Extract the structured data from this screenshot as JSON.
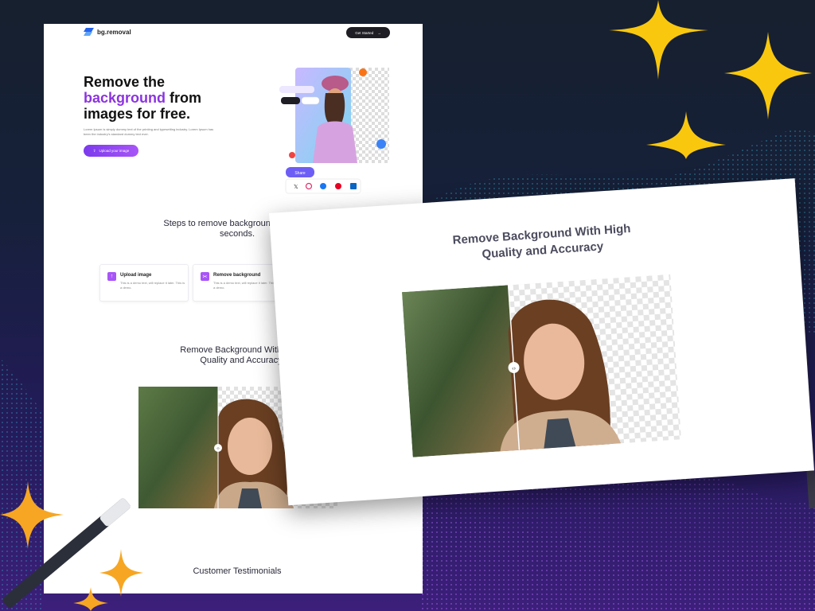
{
  "brand": {
    "name": "bg.removal",
    "accent": "#8b33e0"
  },
  "nav": {
    "cta_label": "Get Started"
  },
  "hero": {
    "title_line1": "Remove the",
    "title_accent": "background",
    "title_after_accent": " from",
    "title_line3": "images for free.",
    "description": "Lorem Ipsum is simply dummy text of the printing and typesetting industry. Lorem Ipsum has been the industry's standard dummy text ever.",
    "upload_label": "Upload your image",
    "mockup": {
      "chip_label": "Remove background",
      "share_label": "Share"
    }
  },
  "steps": {
    "title": "Steps to remove background image in seconds.",
    "cards": [
      {
        "title": "Upload image",
        "desc": "This is a demo text, will replace it later. This is a demo."
      },
      {
        "title": "Remove background",
        "desc": "This is a demo text, will replace it later. This is a demo."
      }
    ]
  },
  "quality": {
    "title_line1": "Remove Background With High",
    "title_line2": "Quality and Accuracy"
  },
  "testimonials": {
    "title": "Customer Testimonials"
  },
  "colors": {
    "star": "#f9c80e",
    "orange_star": "#f6a623",
    "purple": "#a855f7"
  }
}
